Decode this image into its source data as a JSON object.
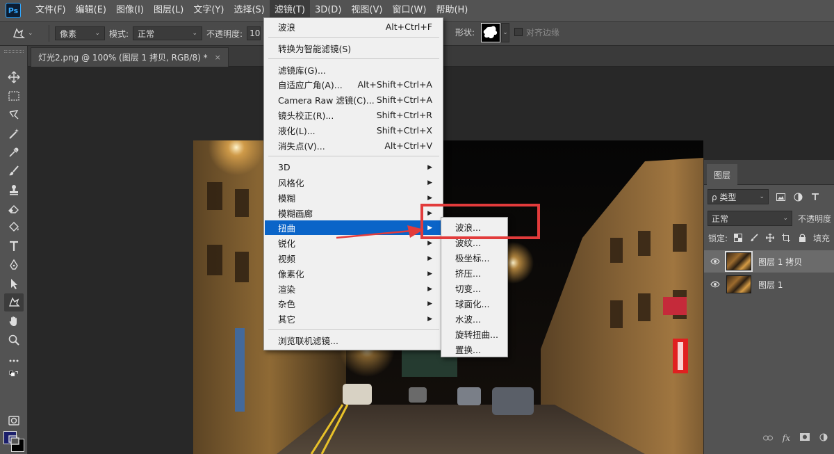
{
  "menubar": {
    "logo": "Ps",
    "items": [
      "文件(F)",
      "编辑(E)",
      "图像(I)",
      "图层(L)",
      "文字(Y)",
      "选择(S)",
      "滤镜(T)",
      "3D(D)",
      "视图(V)",
      "窗口(W)",
      "帮助(H)"
    ],
    "active_index": 6
  },
  "options_bar": {
    "mode_type": "像素",
    "mode_label": "模式:",
    "mode_value": "正常",
    "opacity_label": "不透明度:",
    "opacity_value": "10",
    "shape_label": "形状:",
    "align_edges_label": "对齐边缘"
  },
  "document_tab": {
    "title": "灯光2.png @ 100% (图层 1 拷贝, RGB/8) *",
    "close": "×"
  },
  "filter_menu": {
    "groups": [
      [
        {
          "label": "波浪",
          "shortcut": "Alt+Ctrl+F"
        }
      ],
      [
        {
          "label": "转换为智能滤镜(S)",
          "shortcut": ""
        }
      ],
      [
        {
          "label": "滤镜库(G)...",
          "shortcut": ""
        },
        {
          "label": "自适应广角(A)...",
          "shortcut": "Alt+Shift+Ctrl+A"
        },
        {
          "label": "Camera Raw 滤镜(C)...",
          "shortcut": "Shift+Ctrl+A"
        },
        {
          "label": "镜头校正(R)...",
          "shortcut": "Shift+Ctrl+R"
        },
        {
          "label": "液化(L)...",
          "shortcut": "Shift+Ctrl+X"
        },
        {
          "label": "消失点(V)...",
          "shortcut": "Alt+Ctrl+V"
        }
      ],
      [
        {
          "label": "3D",
          "submenu": true
        },
        {
          "label": "风格化",
          "submenu": true
        },
        {
          "label": "模糊",
          "submenu": true
        },
        {
          "label": "模糊画廊",
          "submenu": true
        },
        {
          "label": "扭曲",
          "submenu": true,
          "highlighted": true
        },
        {
          "label": "锐化",
          "submenu": true
        },
        {
          "label": "视频",
          "submenu": true
        },
        {
          "label": "像素化",
          "submenu": true
        },
        {
          "label": "渲染",
          "submenu": true
        },
        {
          "label": "杂色",
          "submenu": true
        },
        {
          "label": "其它",
          "submenu": true
        }
      ],
      [
        {
          "label": "浏览联机滤镜...",
          "shortcut": ""
        }
      ]
    ],
    "arrow_glyph": "▶"
  },
  "distort_submenu": {
    "items": [
      "波浪...",
      "波纹...",
      "极坐标...",
      "挤压...",
      "切变...",
      "球面化...",
      "水波...",
      "旋转扭曲...",
      "置换..."
    ]
  },
  "layers_panel": {
    "tab": "图层",
    "kind_filter": "ρ 类型",
    "blend_mode": "正常",
    "opacity_label": "不透明度",
    "lock_label": "锁定:",
    "fill_label": "填充",
    "layers": [
      {
        "name": "图层 1 拷贝",
        "selected": true
      },
      {
        "name": "图层 1",
        "selected": false
      }
    ],
    "footer_fx": "fx"
  },
  "colors": {
    "foreground": "#1b1f6b",
    "background": "#000000",
    "menu_highlight": "#0a64c8",
    "annotation": "#e23b3b"
  }
}
